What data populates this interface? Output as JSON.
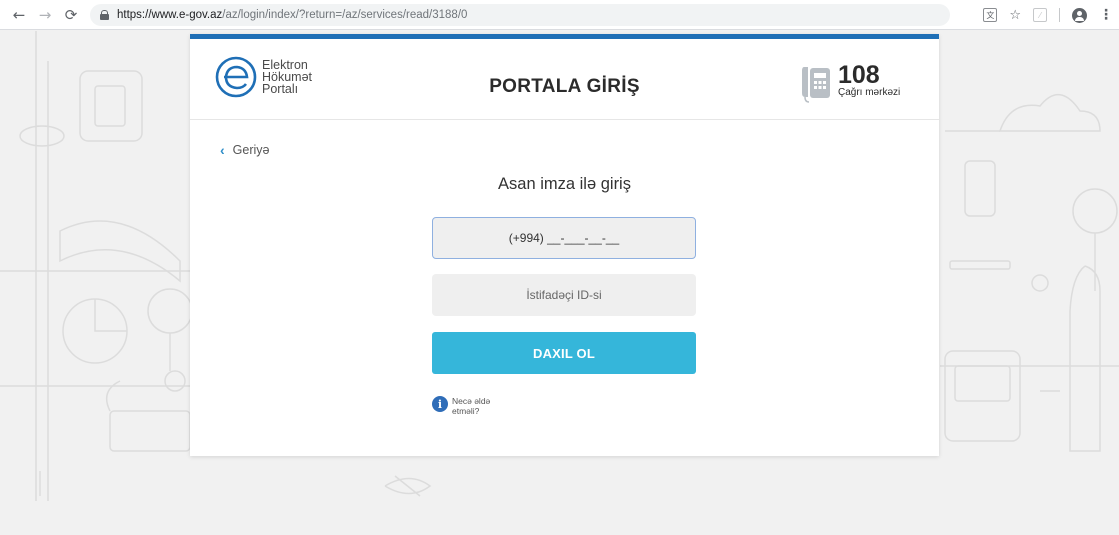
{
  "browser": {
    "url_host": "https://www.e-gov.az",
    "url_path": "/az/login/index/?return=/az/services/read/3188/0"
  },
  "header": {
    "logo_line1": "Elektron",
    "logo_line2": "Hökumət",
    "logo_line3": "Portalı",
    "title": "PORTALA GİRİŞ",
    "call_number": "108",
    "call_label": "Çağrı mərkəzi"
  },
  "form": {
    "back_label": "Geriyə",
    "title": "Asan imza ilə giriş",
    "phone_placeholder": "(+994) __-___-__-__",
    "user_id_placeholder": "İstifadəçi ID-si",
    "submit_label": "DAXIL OL",
    "help_text": "Necə əldə etməli?"
  },
  "colors": {
    "accent": "#35b6da",
    "top_bar": "#1f6fb6",
    "info": "#2f6db8"
  }
}
